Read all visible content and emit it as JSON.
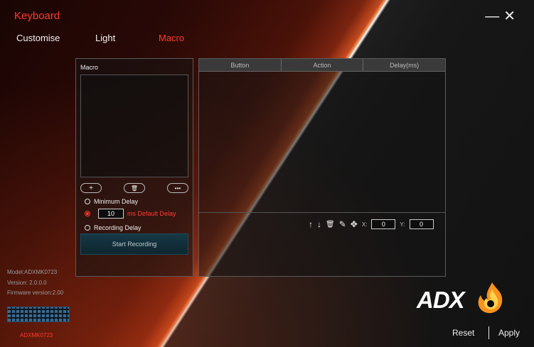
{
  "window": {
    "title": "Keyboard",
    "minimize": "—",
    "close": "✕"
  },
  "tabs": [
    {
      "label": "Customise"
    },
    {
      "label": "Light"
    },
    {
      "label": "Macro",
      "active": true
    }
  ],
  "macro_panel": {
    "label": "Macro",
    "buttons": {
      "add": "+",
      "delete": "🗑",
      "more": "•••"
    },
    "options": {
      "minimum_delay": "Minimum Delay",
      "default_delay_value": "10",
      "default_delay_label": "ms Default Delay",
      "recording_delay": "Recording Delay"
    },
    "start_recording": "Start Recording"
  },
  "table": {
    "columns": [
      "Button",
      "Action",
      "Delay(ms)"
    ],
    "tools": {
      "up": "↑",
      "down": "↓",
      "delete": "🗑",
      "edit": "✎",
      "move": "✥"
    },
    "x_label": "X:",
    "x_value": "0",
    "y_label": "Y:",
    "y_value": "0"
  },
  "device": {
    "model": "Model:ADXMK0723",
    "version": "Version: 2.0.0.0",
    "firmware": "Firmware version:2.00",
    "model_short": "ADXMK0723"
  },
  "logo": {
    "text": "ADX"
  },
  "footer": {
    "reset": "Reset",
    "apply": "Apply"
  },
  "colors": {
    "accent": "#ff3b30",
    "button_bg": "#163845"
  }
}
